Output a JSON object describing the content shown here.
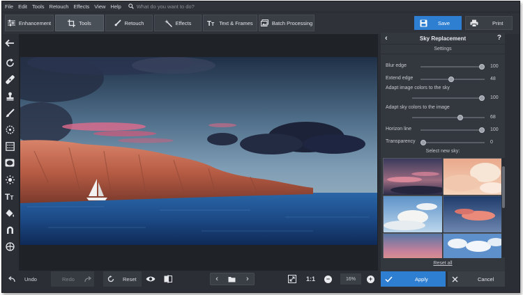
{
  "menu": [
    "File",
    "Edit",
    "Tools",
    "Retouch",
    "Effects",
    "View",
    "Help"
  ],
  "search": {
    "placeholder": "What do you want to do?"
  },
  "tabs": [
    {
      "label": "Enhancement",
      "icon": "sliders-icon"
    },
    {
      "label": "Tools",
      "icon": "crop-icon"
    },
    {
      "label": "Retouch",
      "icon": "brush-icon"
    },
    {
      "label": "Effects",
      "icon": "sparkle-wand-icon"
    },
    {
      "label": "Text & Frames",
      "icon": "text-icon"
    },
    {
      "label": "Batch Processing",
      "icon": "batch-images-icon"
    }
  ],
  "save_label": "Save",
  "print_label": "Print",
  "panel": {
    "title": "Sky Replacement",
    "settings_label": "Settings",
    "sliders": [
      {
        "label": "Blur edge",
        "value": "100",
        "fraction": 1.0
      },
      {
        "label": "Extend edge",
        "value": "48",
        "fraction": 0.48
      },
      {
        "label": "Adapt image colors to the sky",
        "value": "100",
        "fraction": 1.0
      },
      {
        "label": "Adapt sky colors to the image",
        "value": "68",
        "fraction": 0.68
      },
      {
        "label": "Horizon line",
        "value": "100",
        "fraction": 1.0
      },
      {
        "label": "Transparency",
        "value": "0",
        "fraction": 0.0
      }
    ],
    "select_label": "Select new sky:",
    "reset_all": "Reset all"
  },
  "bottom": {
    "undo": "Undo",
    "redo": "Redo",
    "reset": "Reset",
    "zoom_ratio": "1:1",
    "zoom": "16%",
    "apply": "Apply",
    "cancel": "Cancel"
  },
  "colors": {
    "accent": "#2e7fd1",
    "background": "#2b2f35",
    "panel": "#33373e"
  }
}
